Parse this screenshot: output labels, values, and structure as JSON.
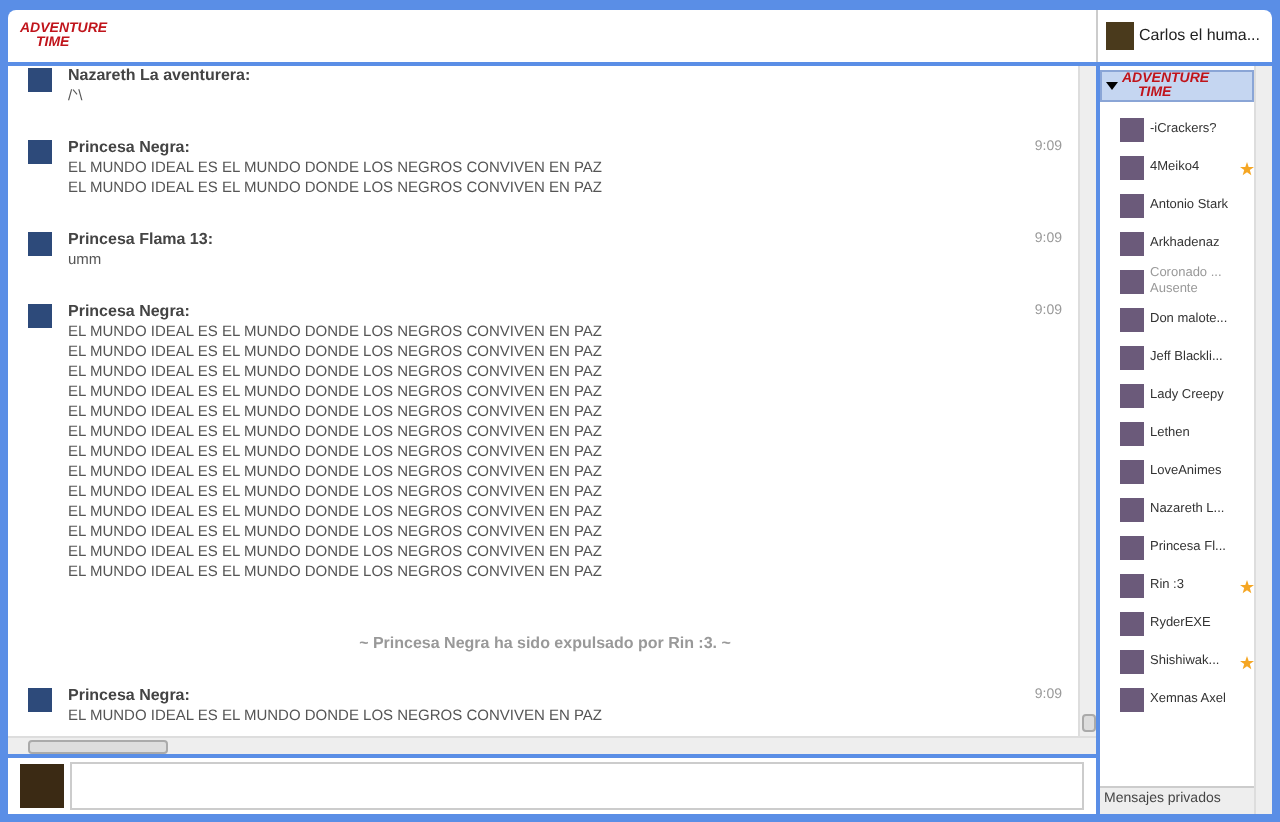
{
  "header": {
    "logo": [
      "ADVENTURE",
      "TIME"
    ],
    "user": "Carlos el huma..."
  },
  "messages": [
    {
      "kind": "message",
      "author": "Nazareth La aventurera:",
      "lines": [
        "/ᐠ\\"
      ]
    },
    {
      "kind": "message",
      "author": "Princesa Negra:",
      "time": "9:09",
      "lines": [
        "EL MUNDO IDEAL ES EL MUNDO DONDE LOS NEGROS CONVIVEN EN PAZ",
        "EL MUNDO IDEAL ES EL MUNDO DONDE LOS NEGROS CONVIVEN EN PAZ"
      ]
    },
    {
      "kind": "message",
      "author": "Princesa Flama 13:",
      "time": "9:09",
      "lines": [
        "umm"
      ]
    },
    {
      "kind": "message",
      "author": "Princesa Negra:",
      "time": "9:09",
      "lines": [
        "EL MUNDO IDEAL ES EL MUNDO DONDE LOS NEGROS CONVIVEN EN PAZ",
        "EL MUNDO IDEAL ES EL MUNDO DONDE LOS NEGROS CONVIVEN EN PAZ",
        "EL MUNDO IDEAL ES EL MUNDO DONDE LOS NEGROS CONVIVEN EN PAZ",
        "EL MUNDO IDEAL ES EL MUNDO DONDE LOS NEGROS CONVIVEN EN PAZ",
        "EL MUNDO IDEAL ES EL MUNDO DONDE LOS NEGROS CONVIVEN EN PAZ",
        "EL MUNDO IDEAL ES EL MUNDO DONDE LOS NEGROS CONVIVEN EN PAZ",
        "EL MUNDO IDEAL ES EL MUNDO DONDE LOS NEGROS CONVIVEN EN PAZ",
        "EL MUNDO IDEAL ES EL MUNDO DONDE LOS NEGROS CONVIVEN EN PAZ",
        "EL MUNDO IDEAL ES EL MUNDO DONDE LOS NEGROS CONVIVEN EN PAZ",
        "EL MUNDO IDEAL ES EL MUNDO DONDE LOS NEGROS CONVIVEN EN PAZ",
        "EL MUNDO IDEAL ES EL MUNDO DONDE LOS NEGROS CONVIVEN EN PAZ",
        "EL MUNDO IDEAL ES EL MUNDO DONDE LOS NEGROS CONVIVEN EN PAZ",
        "EL MUNDO IDEAL ES EL MUNDO DONDE LOS NEGROS CONVIVEN EN PAZ"
      ]
    },
    {
      "kind": "system",
      "text": "~ Princesa Negra ha sido expulsado por Rin :3. ~"
    },
    {
      "kind": "message",
      "author": "Princesa Negra:",
      "time": "9:09",
      "lines": [
        "EL MUNDO IDEAL ES EL MUNDO DONDE LOS NEGROS CONVIVEN EN PAZ"
      ]
    }
  ],
  "sidebar": {
    "logo": [
      "ADVENTURE",
      "TIME"
    ],
    "users": [
      {
        "name": "-iCrackers?",
        "starred": false,
        "away": false
      },
      {
        "name": "4Meiko4",
        "starred": true,
        "away": false
      },
      {
        "name": "Antonio Stark",
        "starred": false,
        "away": false
      },
      {
        "name": "Arkhadenaz",
        "starred": false,
        "away": false
      },
      {
        "name": "Coronado ...",
        "status": "Ausente",
        "starred": false,
        "away": true
      },
      {
        "name": "Don malote...",
        "starred": false,
        "away": false
      },
      {
        "name": "Jeff Blackli...",
        "starred": false,
        "away": false
      },
      {
        "name": "Lady Creepy",
        "starred": false,
        "away": false
      },
      {
        "name": "Lethen",
        "starred": false,
        "away": false
      },
      {
        "name": "LoveAnimes",
        "starred": false,
        "away": false
      },
      {
        "name": "Nazareth L...",
        "starred": false,
        "away": false
      },
      {
        "name": "Princesa Fl...",
        "starred": false,
        "away": false
      },
      {
        "name": "Rin :3",
        "starred": true,
        "away": false
      },
      {
        "name": "RyderEXE",
        "starred": false,
        "away": false
      },
      {
        "name": "Shishiwak...",
        "starred": true,
        "away": false
      },
      {
        "name": "Xemnas Axel",
        "starred": false,
        "away": false
      }
    ],
    "private_header": "Mensajes privados"
  }
}
